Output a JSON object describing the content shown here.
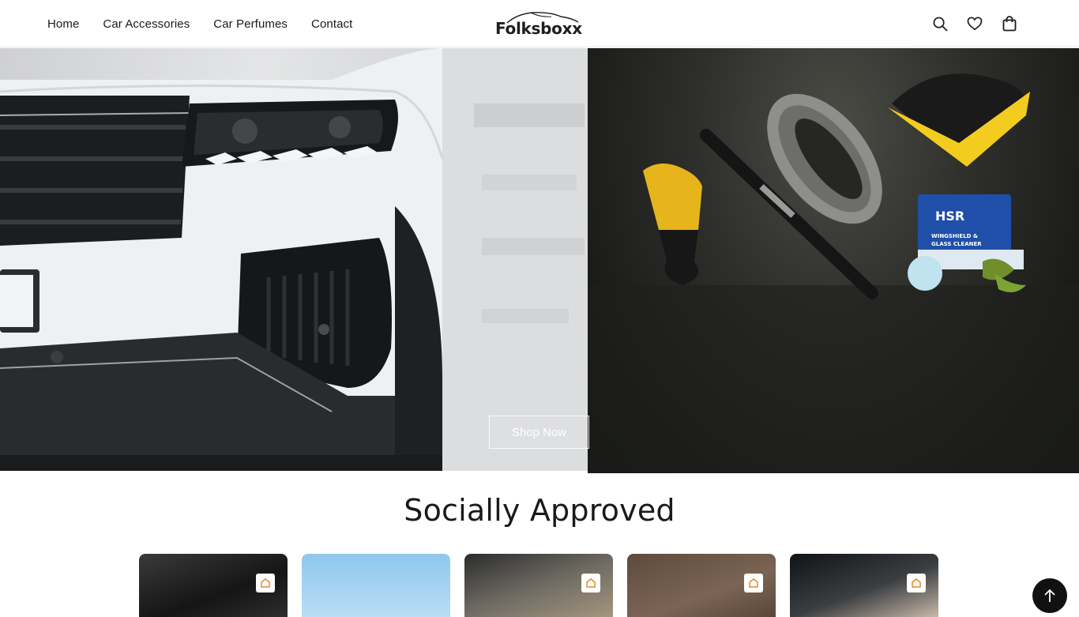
{
  "header": {
    "nav": [
      "Home",
      "Car Accessories",
      "Car Perfumes",
      "Contact"
    ],
    "logo": "Folksboxx",
    "icons": [
      "search-icon",
      "heart-icon",
      "bag-icon"
    ]
  },
  "hero": {
    "cta": "Shop Now",
    "product_label": "HSR",
    "product_sublabel": "WINGSHIELD & GLASS CLEANER"
  },
  "social": {
    "title": "Socially Approved",
    "cards": [
      {
        "bg": "#2a2a2a"
      },
      {
        "bg": "#a9d3f0"
      },
      {
        "bg": "#8a7b6a"
      },
      {
        "bg": "#6f5a4b"
      },
      {
        "bg": "#1e2226"
      }
    ]
  },
  "colors": {
    "accent": "#111111",
    "cleaner_yellow": "#f2cc1f"
  }
}
